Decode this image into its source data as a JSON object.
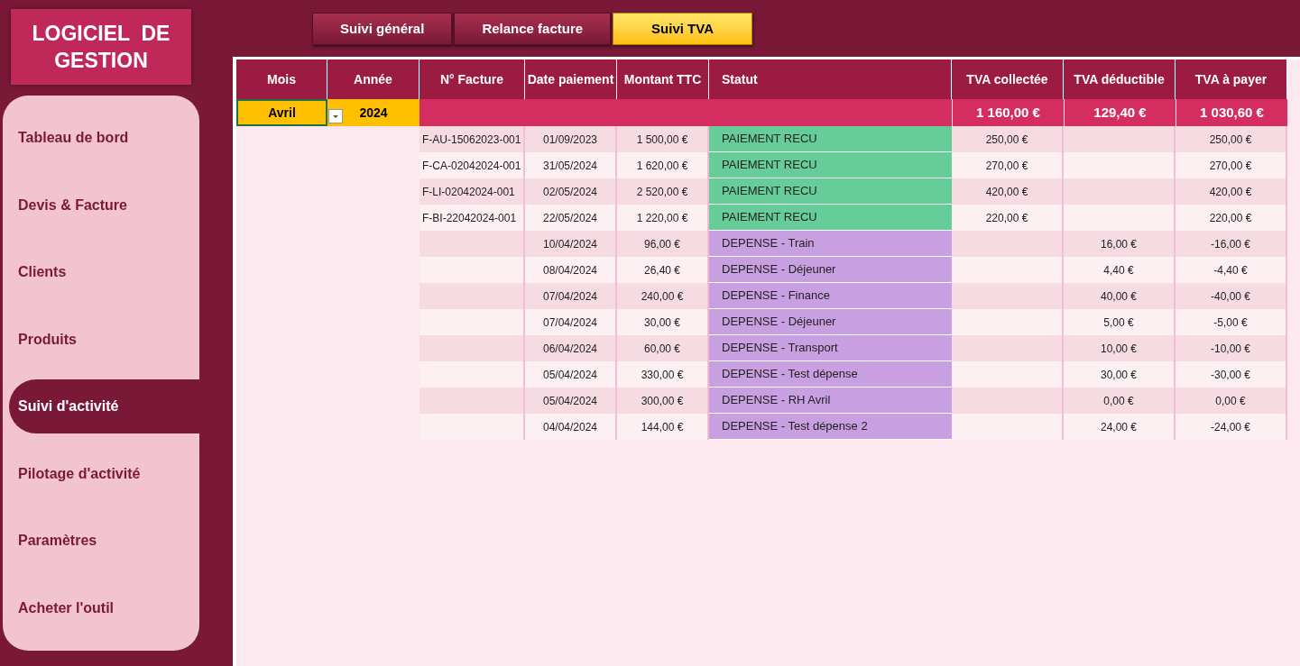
{
  "logo": {
    "title": "LOGICIEL  DE GESTION"
  },
  "sidebar": {
    "items": [
      {
        "label": "Tableau de bord",
        "selected": false
      },
      {
        "label": "Devis & Facture",
        "selected": false
      },
      {
        "label": "Clients",
        "selected": false
      },
      {
        "label": "Produits",
        "selected": false
      },
      {
        "label": "Suivi d'activité",
        "selected": true
      },
      {
        "label": "Pilotage d'activité",
        "selected": false
      },
      {
        "label": "Paramètres",
        "selected": false
      },
      {
        "label": "Acheter l'outil",
        "selected": false
      }
    ]
  },
  "tabs": [
    {
      "label": "Suivi général",
      "selected": false
    },
    {
      "label": "Relance facture",
      "selected": false
    },
    {
      "label": "Suivi TVA",
      "selected": true
    }
  ],
  "table": {
    "columns": [
      "Mois",
      "Année",
      "N° Facture",
      "Date paiement",
      "Montant TTC",
      "Statut",
      "TVA collectée",
      "TVA déductible",
      "TVA à payer"
    ],
    "filter": {
      "month": "Avril",
      "year": "2024"
    },
    "totals": [
      "1 160,00 €",
      "129,40 €",
      "1 030,60 €"
    ],
    "rows": [
      {
        "invoice": "F-AU-15062023-001",
        "date": "01/09/2023",
        "amount": "1 500,00 €",
        "status": "PAIEMENT RECU",
        "kind": "payment",
        "tva_collected": "250,00 €",
        "tva_deductible": "",
        "tva_payable": "250,00 €"
      },
      {
        "invoice": "F-CA-02042024-001",
        "date": "31/05/2024",
        "amount": "1 620,00 €",
        "status": "PAIEMENT RECU",
        "kind": "payment",
        "tva_collected": "270,00 €",
        "tva_deductible": "",
        "tva_payable": "270,00 €"
      },
      {
        "invoice": "F-LI-02042024-001",
        "date": "02/05/2024",
        "amount": "2 520,00 €",
        "status": "PAIEMENT RECU",
        "kind": "payment",
        "tva_collected": "420,00 €",
        "tva_deductible": "",
        "tva_payable": "420,00 €"
      },
      {
        "invoice": "F-BI-22042024-001",
        "date": "22/05/2024",
        "amount": "1 220,00 €",
        "status": "PAIEMENT RECU",
        "kind": "payment",
        "tva_collected": "220,00 €",
        "tva_deductible": "",
        "tva_payable": "220,00 €"
      },
      {
        "invoice": "",
        "date": "10/04/2024",
        "amount": "96,00 €",
        "status": "DEPENSE - Train",
        "kind": "expense",
        "tva_collected": "",
        "tva_deductible": "16,00 €",
        "tva_payable": "-16,00 €"
      },
      {
        "invoice": "",
        "date": "08/04/2024",
        "amount": "26,40 €",
        "status": "DEPENSE - Déjeuner",
        "kind": "expense",
        "tva_collected": "",
        "tva_deductible": "4,40 €",
        "tva_payable": "-4,40 €"
      },
      {
        "invoice": "",
        "date": "07/04/2024",
        "amount": "240,00 €",
        "status": "DEPENSE - Finance",
        "kind": "expense",
        "tva_collected": "",
        "tva_deductible": "40,00 €",
        "tva_payable": "-40,00 €"
      },
      {
        "invoice": "",
        "date": "07/04/2024",
        "amount": "30,00 €",
        "status": "DEPENSE - Déjeuner",
        "kind": "expense",
        "tva_collected": "",
        "tva_deductible": "5,00 €",
        "tva_payable": "-5,00 €"
      },
      {
        "invoice": "",
        "date": "06/04/2024",
        "amount": "60,00 €",
        "status": "DEPENSE - Transport",
        "kind": "expense",
        "tva_collected": "",
        "tva_deductible": "10,00 €",
        "tva_payable": "-10,00 €"
      },
      {
        "invoice": "",
        "date": "05/04/2024",
        "amount": "330,00 €",
        "status": "DEPENSE - Test dépense",
        "kind": "expense",
        "tva_collected": "",
        "tva_deductible": "30,00 €",
        "tva_payable": "-30,00 €"
      },
      {
        "invoice": "",
        "date": "05/04/2024",
        "amount": "300,00 €",
        "status": "DEPENSE - RH Avril",
        "kind": "expense",
        "tva_collected": "",
        "tva_deductible": "0,00 €",
        "tva_payable": "0,00 €"
      },
      {
        "invoice": "",
        "date": "04/04/2024",
        "amount": "144,00 €",
        "status": "DEPENSE - Test dépense 2",
        "kind": "expense",
        "tva_collected": "",
        "tva_deductible": "24,00 €",
        "tva_payable": "-24,00 €"
      }
    ]
  }
}
